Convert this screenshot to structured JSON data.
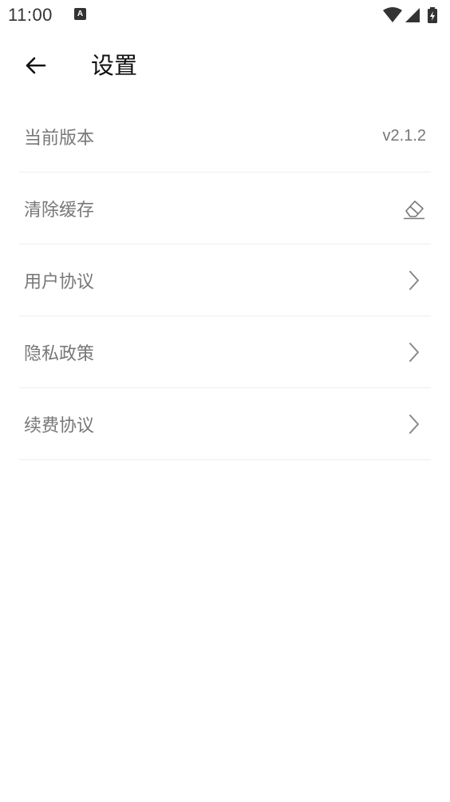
{
  "status_bar": {
    "time": "11:00",
    "notification_icon": "A",
    "icons": [
      "wifi-icon",
      "signal-icon",
      "battery-charging-icon"
    ]
  },
  "app_bar": {
    "back_icon": "arrow-left-icon",
    "title": "设置"
  },
  "settings": {
    "items": [
      {
        "label": "当前版本",
        "value": "v2.1.2"
      },
      {
        "label": "清除缓存",
        "icon": "eraser-icon"
      },
      {
        "label": "用户协议",
        "icon": "chevron-right-icon"
      },
      {
        "label": "隐私政策",
        "icon": "chevron-right-icon"
      },
      {
        "label": "续费协议",
        "icon": "chevron-right-icon"
      }
    ]
  },
  "colors": {
    "background": "#ffffff",
    "label": "#777777",
    "title": "#111111",
    "divider": "#efefef",
    "icon": "#888888"
  }
}
